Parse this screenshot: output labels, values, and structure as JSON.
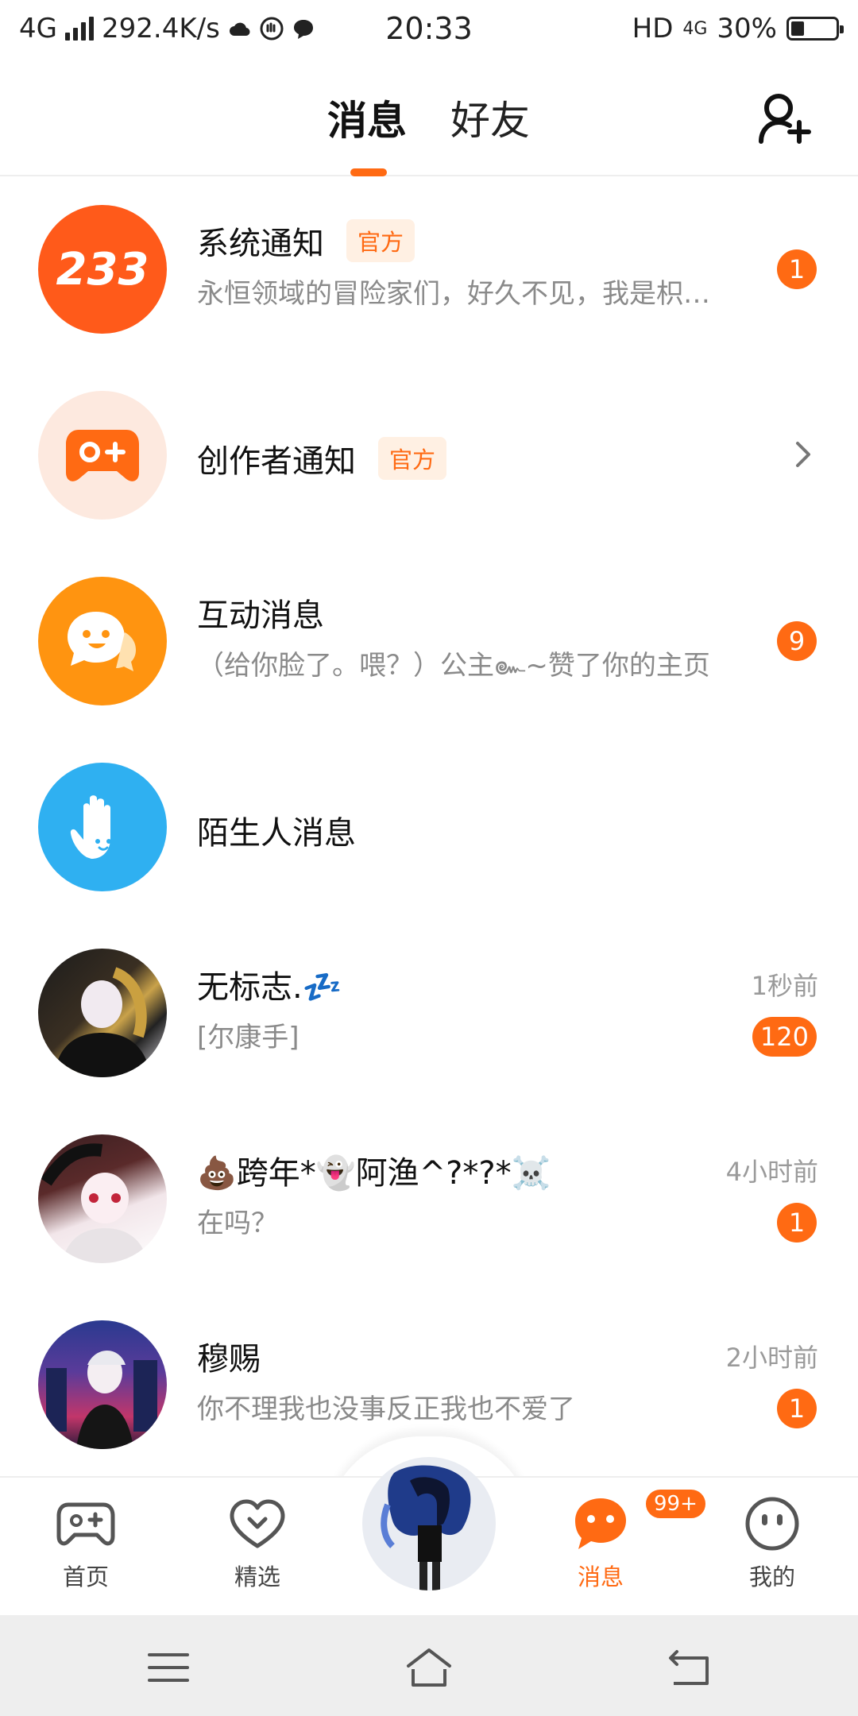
{
  "status_bar": {
    "network": "4G",
    "speed": "292.4K/s",
    "time": "20:33",
    "hd": "HD",
    "net2": "4G",
    "battery": "30%",
    "battery_level": 0.3
  },
  "header": {
    "tabs": [
      {
        "label": "消息"
      },
      {
        "label": "好友"
      }
    ]
  },
  "messages": [
    {
      "title": "系统通知",
      "tag": "官方",
      "subtitle": "永恒领域的冒险家们，好久不见，我是枳…",
      "count": "1"
    },
    {
      "title": "创作者通知",
      "tag": "官方"
    },
    {
      "title": "互动消息",
      "subtitle": "（给你脸了。喂？）公主๛~赞了你的主页",
      "count": "9"
    },
    {
      "title": "陌生人消息"
    },
    {
      "title": "无标志.💤",
      "subtitle": "[尔康手]",
      "time": "1秒前",
      "count": "120"
    },
    {
      "title": "💩跨年*👻阿渔^?*?*☠️",
      "subtitle": "在吗？",
      "time": "4小时前",
      "count": "1"
    },
    {
      "title": "穆赐",
      "subtitle": "你不理我也没事反正我也不爱了",
      "time": "2小时前",
      "count": "1"
    }
  ],
  "system_avatar_text": "233",
  "bottom_nav": {
    "items": [
      {
        "label": "首页"
      },
      {
        "label": "精选"
      },
      {
        "label": "消息",
        "badge": "99+"
      },
      {
        "label": "我的"
      }
    ]
  },
  "colors": {
    "accent": "#ff6a13",
    "interaction_avatar": "#ff9410",
    "stranger_avatar": "#2fb0f1"
  }
}
